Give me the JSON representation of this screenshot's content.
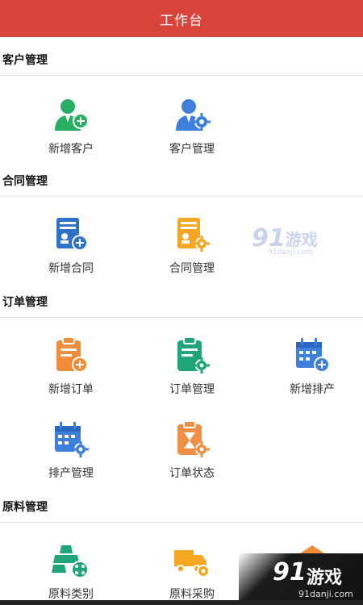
{
  "appbar": {
    "title": "工作台"
  },
  "sections": [
    {
      "label": "客户管理",
      "items": [
        {
          "label": "新增客户",
          "icon": "add-customer-icon"
        },
        {
          "label": "客户管理",
          "icon": "customer-manage-icon"
        }
      ]
    },
    {
      "label": "合同管理",
      "items": [
        {
          "label": "新增合同",
          "icon": "add-contract-icon"
        },
        {
          "label": "合同管理",
          "icon": "contract-manage-icon"
        }
      ]
    },
    {
      "label": "订单管理",
      "items": [
        {
          "label": "新增订单",
          "icon": "add-order-icon"
        },
        {
          "label": "订单管理",
          "icon": "order-manage-icon"
        },
        {
          "label": "新增排产",
          "icon": "add-schedule-icon"
        },
        {
          "label": "排产管理",
          "icon": "schedule-manage-icon"
        },
        {
          "label": "订单状态",
          "icon": "order-status-icon"
        }
      ]
    },
    {
      "label": "原料管理",
      "items": [
        {
          "label": "原料类别",
          "icon": "material-category-icon"
        },
        {
          "label": "原料采购",
          "icon": "material-purchase-icon"
        }
      ]
    }
  ],
  "watermark": {
    "logo_num": "91",
    "logo_text": "游戏",
    "url": "91danji.com"
  },
  "badge": {
    "logo_num": "91",
    "logo_text": "游戏",
    "url": "91danji.com"
  },
  "colors": {
    "appbar": "#d9443c",
    "green": "#27ae60",
    "blue": "#3f7fdc",
    "orange": "#f08c3a",
    "amber": "#f5a623"
  }
}
